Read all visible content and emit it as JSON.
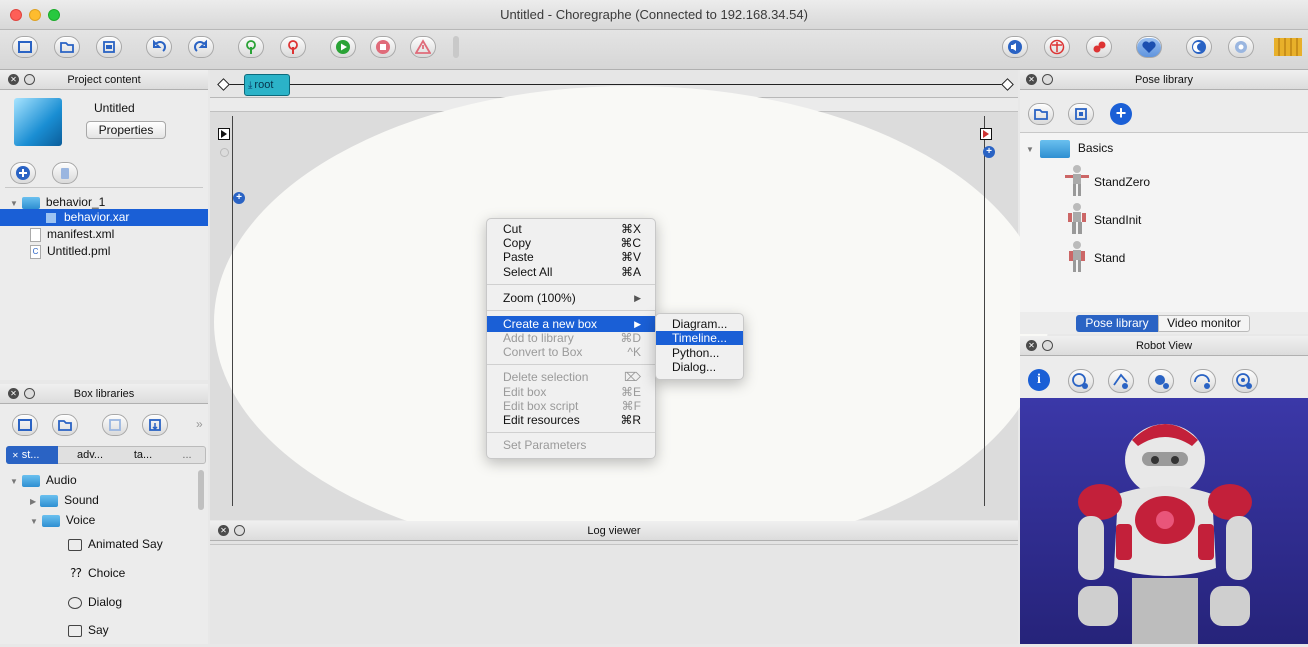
{
  "window": {
    "title": "Untitled - Choregraphe (Connected to 192.168.34.54)"
  },
  "toolbar": {
    "left_icons": [
      "new-project-icon",
      "open-project-icon",
      "save-project-icon",
      "undo-icon",
      "redo-icon",
      "connect-icon",
      "disconnect-icon",
      "play-icon",
      "stop-icon",
      "warning-icon"
    ],
    "right_icons": [
      "volume-icon",
      "animation-mode-icon",
      "motors-icon",
      "life-icon",
      "sleep-icon",
      "settings-icon",
      "battery-icon"
    ]
  },
  "project_content": {
    "header": "Project content",
    "project_name": "Untitled",
    "properties_label": "Properties",
    "tree": [
      {
        "label": "behavior_1",
        "type": "folder",
        "expanded": true
      },
      {
        "label": "behavior.xar",
        "type": "behavior",
        "selected": true
      },
      {
        "label": "manifest.xml",
        "type": "file"
      },
      {
        "label": "Untitled.pml",
        "type": "pml"
      }
    ]
  },
  "box_libraries": {
    "header": "Box libraries",
    "tabs": [
      "st...",
      "adv...",
      "ta...",
      "..."
    ],
    "tree": [
      {
        "label": "Audio",
        "type": "folder"
      },
      {
        "label": "Sound",
        "type": "folder"
      },
      {
        "label": "Voice",
        "type": "folder"
      },
      {
        "label": "Animated Say",
        "type": "box"
      },
      {
        "label": "Choice",
        "type": "box"
      },
      {
        "label": "Dialog",
        "type": "box"
      },
      {
        "label": "Say",
        "type": "box"
      }
    ]
  },
  "diagram": {
    "breadcrumb_root": "root"
  },
  "context_menu": {
    "items": [
      {
        "label": "Cut",
        "shortcut": "⌘X",
        "enabled": true
      },
      {
        "label": "Copy",
        "shortcut": "⌘C",
        "enabled": true
      },
      {
        "label": "Paste",
        "shortcut": "⌘V",
        "enabled": true
      },
      {
        "label": "Select All",
        "shortcut": "⌘A",
        "enabled": true
      },
      {
        "label": "Zoom (100%)",
        "shortcut": "▶",
        "enabled": true
      },
      {
        "label": "Create a new box",
        "shortcut": "▶",
        "enabled": true,
        "highlighted": true
      },
      {
        "label": "Add to library",
        "shortcut": "⌘D",
        "enabled": false
      },
      {
        "label": "Convert to Box",
        "shortcut": "^K",
        "enabled": false
      },
      {
        "label": "Delete selection",
        "shortcut": "⌦",
        "enabled": false
      },
      {
        "label": "Edit box",
        "shortcut": "⌘E",
        "enabled": false
      },
      {
        "label": "Edit box script",
        "shortcut": "⌘F",
        "enabled": false
      },
      {
        "label": "Edit resources",
        "shortcut": "⌘R",
        "enabled": true
      },
      {
        "label": "Set Parameters",
        "shortcut": "",
        "enabled": false
      }
    ],
    "submenu": [
      {
        "label": "Diagram...",
        "highlighted": false
      },
      {
        "label": "Timeline...",
        "highlighted": true
      },
      {
        "label": "Python...",
        "highlighted": false
      },
      {
        "label": "Dialog...",
        "highlighted": false
      }
    ]
  },
  "log_viewer": {
    "header": "Log viewer"
  },
  "pose_library": {
    "header": "Pose library",
    "folder": "Basics",
    "poses": [
      "StandZero",
      "StandInit",
      "Stand"
    ],
    "tabs": [
      "Pose library",
      "Video monitor"
    ],
    "active_tab": "Pose library"
  },
  "robot_view": {
    "header": "Robot View"
  },
  "colors": {
    "selection": "#1a5fd6",
    "accent_blue": "#2a63c4",
    "robot_bg": "#2e2b8c"
  }
}
